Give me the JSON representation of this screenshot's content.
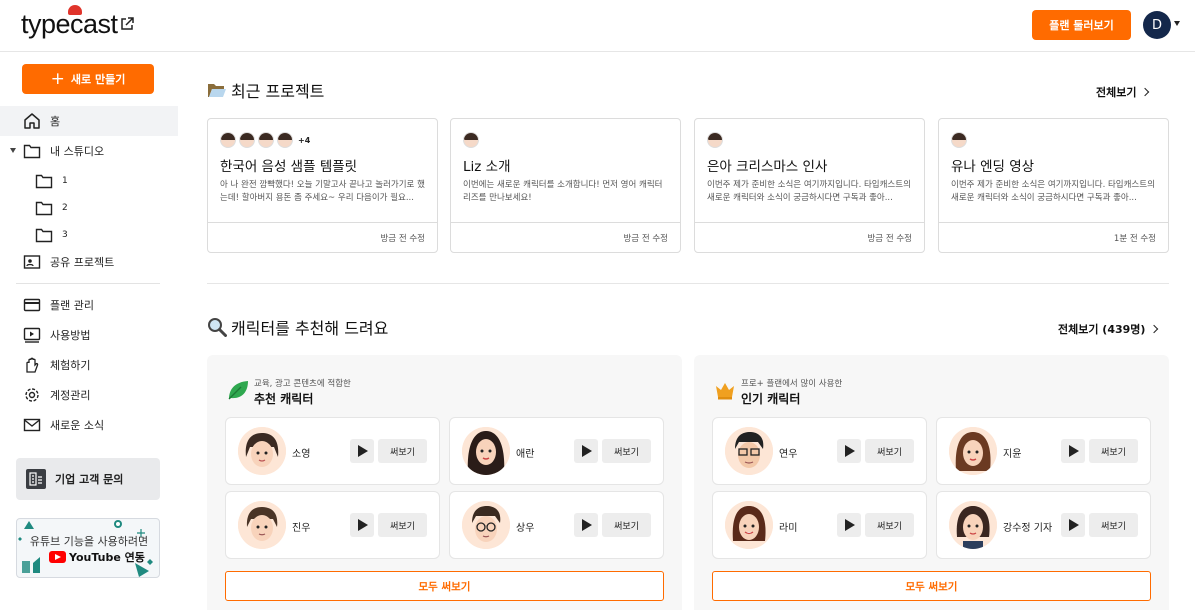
{
  "header": {
    "logo": "typecast",
    "plan_button": "플랜 둘러보기",
    "avatar_initial": "D"
  },
  "sidebar": {
    "new_button": "새로 만들기",
    "home": "홈",
    "my_studio": "내 스튜디오",
    "folders": [
      "1",
      "2",
      "3"
    ],
    "shared": "공유 프로젝트",
    "plan_manage": "플랜 관리",
    "howto": "사용방법",
    "trial": "체험하기",
    "account": "계정관리",
    "news": "새로운 소식",
    "enterprise": "기업 고객 문의",
    "youtube_line1": "유튜브 기능을 사용하려면",
    "youtube_line2": "YouTube 연동"
  },
  "recent": {
    "title": "최근 프로젝트",
    "view_all": "전체보기",
    "projects": [
      {
        "title": "한국어 음성 샘플 템플릿",
        "desc": "아 나 완전 깜빡했다! 오늘 기말고사 끝나고 놀러가기로 했는데! 할아버지 용돈 좀 주세요~ 우리 다음이가 필요...",
        "time": "방금 전 수정",
        "extra": "+4"
      },
      {
        "title": "Liz 소개",
        "desc": "이번에는 새로운 캐릭터를 소개합니다! 먼저 영어 캐릭터 리즈를 만나보세요!",
        "time": "방금 전 수정"
      },
      {
        "title": "은아 크리스마스 인사",
        "desc": "이번주 제가 준비한 소식은 여기까지입니다. 타입캐스트의 새로운 캐릭터와 소식이 궁금하시다면 구독과 좋아...",
        "time": "방금 전 수정"
      },
      {
        "title": "유나 엔딩 영상",
        "desc": "이번주 제가 준비한 소식은 여기까지입니다. 타입캐스트의 새로운 캐릭터와 소식이 궁금하시다면 구독과 좋아...",
        "time": "1분 전 수정"
      }
    ]
  },
  "characters": {
    "title": "캐릭터를 추천해 드려요",
    "view_all": "전체보기 (439명)",
    "try_label": "써보기",
    "all_button": "모두 써보기",
    "panels": [
      {
        "tag": "교육, 광고 콘텐츠에 적합한",
        "name": "추천 캐릭터",
        "items": [
          "소영",
          "애란",
          "진우",
          "상우"
        ]
      },
      {
        "tag": "프로+ 플랜에서 많이 사용한",
        "name": "인기 캐릭터",
        "items": [
          "연우",
          "지윤",
          "라미",
          "강수정 기자"
        ]
      }
    ]
  },
  "colors": {
    "accent": "#ff6b00",
    "avatar_bg": "#14284b"
  }
}
